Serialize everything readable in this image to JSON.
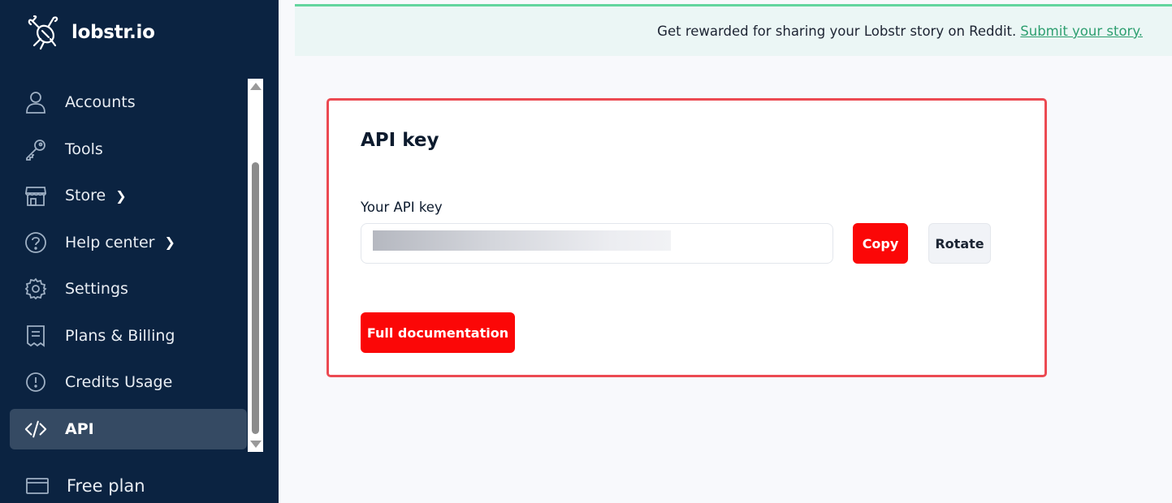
{
  "brand": {
    "name": "lobstr.io",
    "logo_icon": "lobster-icon"
  },
  "sidebar": {
    "items": [
      {
        "label": "Accounts",
        "icon": "user-icon",
        "active": false,
        "has_chevron": false
      },
      {
        "label": "Tools",
        "icon": "key-icon",
        "active": false,
        "has_chevron": false
      },
      {
        "label": "Store",
        "icon": "store-icon",
        "active": false,
        "has_chevron": true,
        "chevron": "❯"
      },
      {
        "label": "Help center",
        "icon": "help-icon",
        "active": false,
        "has_chevron": true,
        "chevron": "❯"
      },
      {
        "label": "Settings",
        "icon": "gear-icon",
        "active": false,
        "has_chevron": false
      },
      {
        "label": "Plans & Billing",
        "icon": "receipt-icon",
        "active": false,
        "has_chevron": false
      },
      {
        "label": "Credits Usage",
        "icon": "alert-circle-icon",
        "active": false,
        "has_chevron": false
      },
      {
        "label": "API",
        "icon": "code-icon",
        "active": true,
        "has_chevron": false
      }
    ],
    "plan": {
      "label": "Free plan",
      "icon": "credit-card-icon"
    },
    "colors": {
      "background": "#0b2341",
      "active": "#354a63"
    }
  },
  "banner": {
    "text": "Get rewarded for sharing your Lobstr story on Reddit.",
    "link": "Submit your story."
  },
  "api_card": {
    "title": "API key",
    "field_label": "Your API key",
    "copy_label": "Copy",
    "rotate_label": "Rotate",
    "docs_label": "Full documentation"
  },
  "colors": {
    "accent": "#fb0707",
    "highlight_border": "#ec4a52",
    "banner_border": "#63d59e",
    "link": "#2e9f70"
  }
}
